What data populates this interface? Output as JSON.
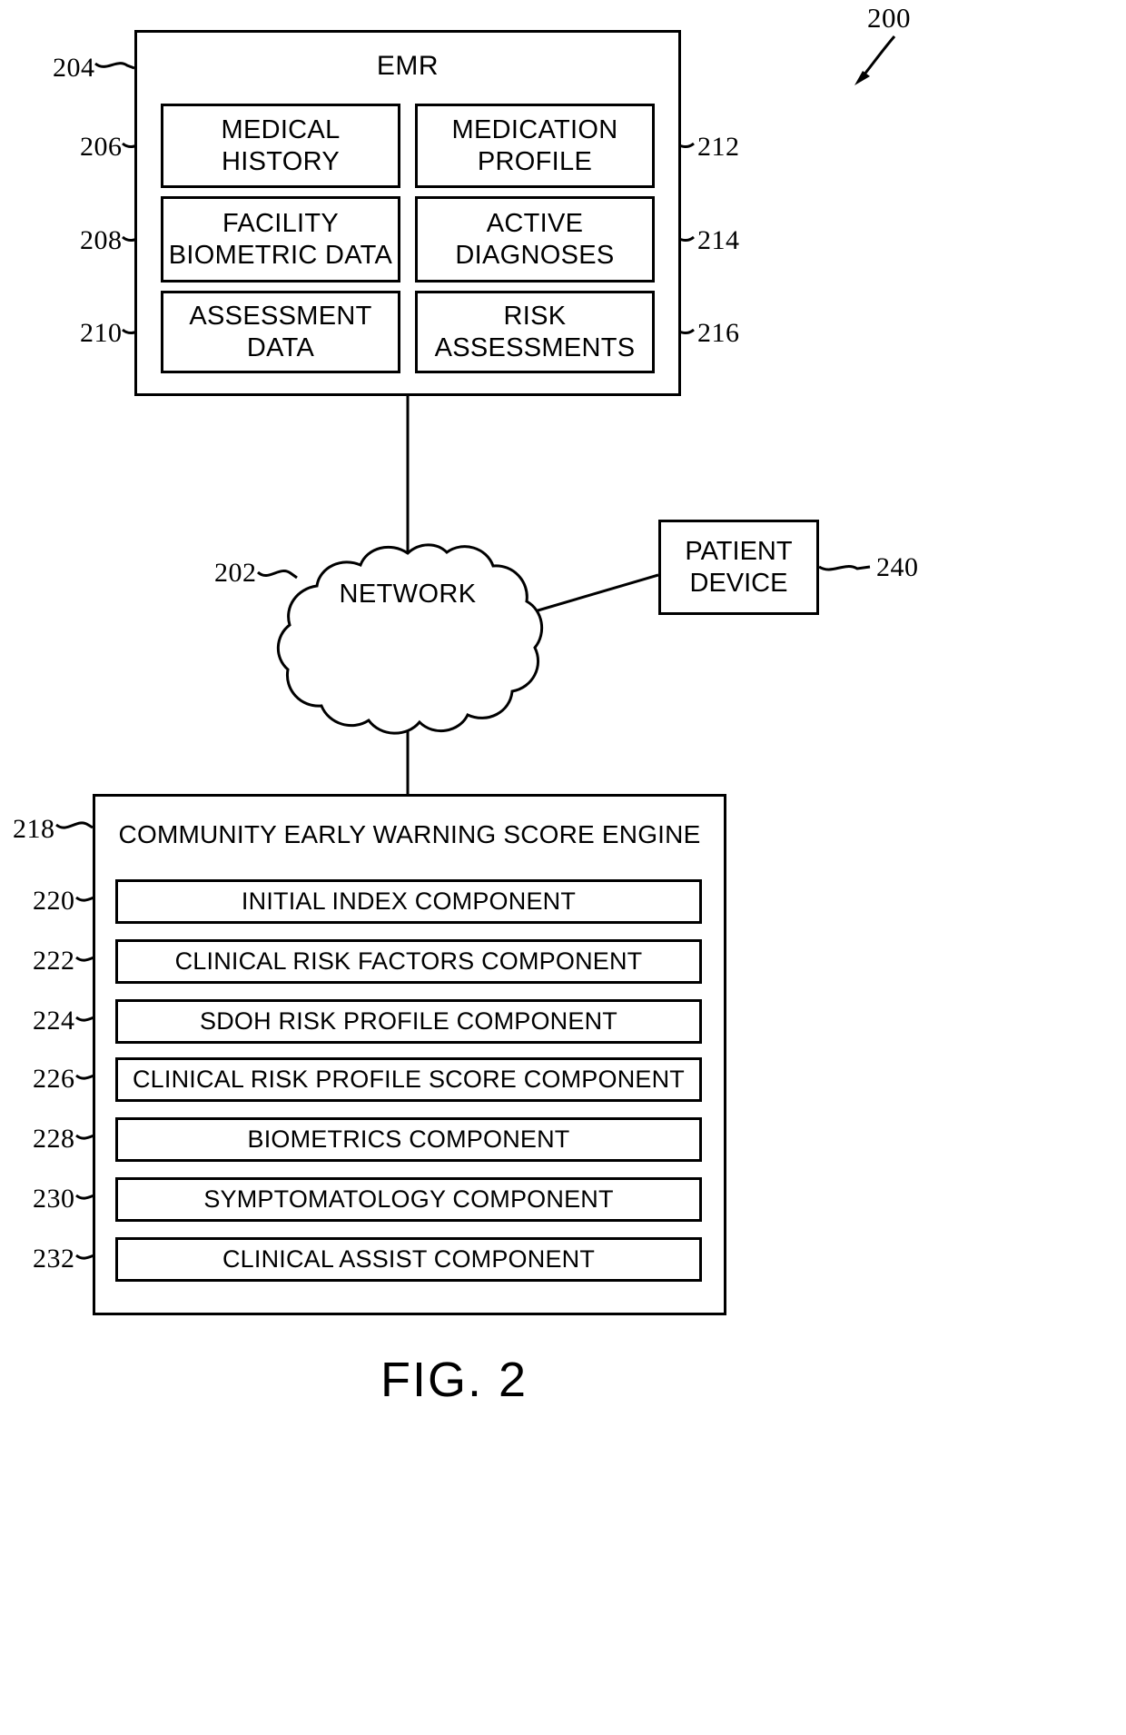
{
  "figure": {
    "number": "200",
    "caption": "FIG. 2"
  },
  "emr": {
    "ref": "204",
    "title": "EMR",
    "cells": [
      {
        "ref": "206",
        "label": "MEDICAL\nHISTORY",
        "line1": "MEDICAL",
        "line2": "HISTORY"
      },
      {
        "ref": "212",
        "label": "MEDICATION\nPROFILE",
        "line1": "MEDICATION",
        "line2": "PROFILE"
      },
      {
        "ref": "208",
        "label": "FACILITY\nBIOMETRIC DATA",
        "line1": "FACILITY",
        "line2": "BIOMETRIC DATA"
      },
      {
        "ref": "214",
        "label": "ACTIVE\nDIAGNOSES",
        "line1": "ACTIVE",
        "line2": "DIAGNOSES"
      },
      {
        "ref": "210",
        "label": "ASSESSMENT\nDATA",
        "line1": "ASSESSMENT",
        "line2": "DATA"
      },
      {
        "ref": "216",
        "label": "RISK\nASSESSMENTS",
        "line1": "RISK",
        "line2": "ASSESSMENTS"
      }
    ]
  },
  "network": {
    "ref": "202",
    "label": "NETWORK"
  },
  "patient_device": {
    "ref": "240",
    "line1": "PATIENT",
    "line2": "DEVICE"
  },
  "cews": {
    "ref": "218",
    "title": "COMMUNITY EARLY WARNING SCORE ENGINE",
    "items": [
      {
        "ref": "220",
        "label": "INITIAL INDEX COMPONENT"
      },
      {
        "ref": "222",
        "label": "CLINICAL RISK FACTORS COMPONENT"
      },
      {
        "ref": "224",
        "label": "SDOH RISK PROFILE COMPONENT"
      },
      {
        "ref": "226",
        "label": "CLINICAL RISK PROFILE SCORE COMPONENT"
      },
      {
        "ref": "228",
        "label": "BIOMETRICS COMPONENT"
      },
      {
        "ref": "230",
        "label": "SYMPTOMATOLOGY COMPONENT"
      },
      {
        "ref": "232",
        "label": "CLINICAL ASSIST COMPONENT"
      }
    ]
  },
  "colors": {
    "line": "#000000",
    "background": "#ffffff"
  }
}
